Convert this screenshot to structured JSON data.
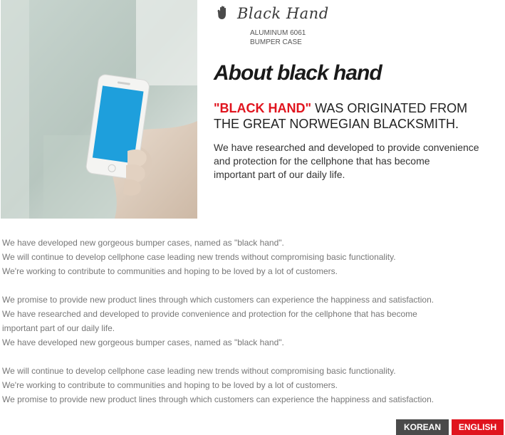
{
  "brand": {
    "name": "Black Hand",
    "logo_icon": "hand-icon",
    "product_line1": "ALUMINUM 6061",
    "product_line2": "BUMPER CASE"
  },
  "hero": {
    "image": "hand-holding-smartphone-photo",
    "phone_screen_color": "#1e9fdc"
  },
  "title": "About black hand",
  "headline": {
    "accent": "\"BLACK HAND\"",
    "line1_rest": " WAS ORIGINATED FROM",
    "line2": "THE GREAT NORWEGIAN BLACKSMITH."
  },
  "intro": [
    "We have researched and developed to provide convenience",
    "and protection for the cellphone that has become",
    "important part of our daily life."
  ],
  "paragraphs": [
    [
      "We have developed new gorgeous bumper cases, named as \"black hand\".",
      "We will continue to develop cellphone case leading new trends without compromising basic functionality.",
      "We're working to contribute to communities and hoping to be loved by a lot of customers."
    ],
    [
      "We promise to provide new product lines through which customers can experience the happiness and satisfaction.",
      "We have researched and developed to provide convenience and protection for the cellphone that has become",
      "important part of our daily life.",
      "We have developed new gorgeous bumper cases, named as \"black hand\"."
    ],
    [
      "We will continue to develop cellphone case leading new trends without compromising basic functionality.",
      "We're working to contribute to communities and hoping to be loved by a lot of customers.",
      "We promise to provide new product lines through which customers can experience the happiness and satisfaction."
    ]
  ],
  "language": {
    "korean": "KOREAN",
    "english": "ENGLISH",
    "active": "english"
  },
  "colors": {
    "accent": "#e0141e",
    "korean_button": "#4a4a4a",
    "body_text": "#777777"
  }
}
